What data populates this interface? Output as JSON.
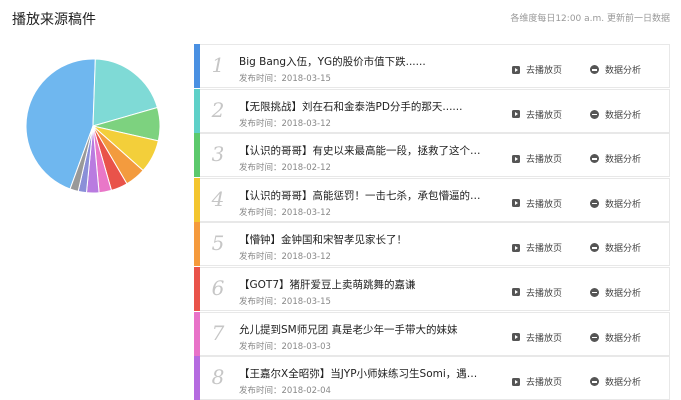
{
  "header": {
    "title": "播放来源稿件",
    "note": "各维度每日12:00 a.m. 更新前一日数据"
  },
  "actions": {
    "play_label": "去播放页",
    "analysis_label": "数据分析",
    "date_prefix": "发布时间："
  },
  "items": [
    {
      "rank": "1",
      "title": "Big Bang入伍，YG的股价市值下跌......",
      "date": "2018-03-15",
      "color": "#4a90e2"
    },
    {
      "rank": "2",
      "title": "【无限挑战】刘在石和金泰浩PD分手的那天......",
      "date": "2018-03-12",
      "color": "#5ed0c8"
    },
    {
      "rank": "3",
      "title": "【认识的哥哥】有史以来最高能一段，拯救了这个节目",
      "date": "2018-02-12",
      "color": "#5cc96c"
    },
    {
      "rank": "4",
      "title": "【认识的哥哥】高能惩罚！一击七杀，承包懵逼的王...",
      "date": "2018-03-12",
      "color": "#f3c52f"
    },
    {
      "rank": "5",
      "title": "【懵钟】金钟国和宋智孝见家长了！",
      "date": "2018-03-12",
      "color": "#f59a3c"
    },
    {
      "rank": "6",
      "title": "【GOT7】猪肝爱豆上卖萌跳舞的嘉谦",
      "date": "2018-03-15",
      "color": "#e9534a"
    },
    {
      "rank": "7",
      "title": "允儿提到SM师兄团 真是老少年一手带大的妹妹",
      "date": "2018-03-03",
      "color": "#e872c8"
    },
    {
      "rank": "8",
      "title": "【王嘉尔X全昭弥】当JYP小师妹练习生Somi，遇到师...",
      "date": "2018-02-04",
      "color": "#b56be0"
    }
  ],
  "chart_data": {
    "type": "pie",
    "values": [
      45,
      20,
      8,
      8,
      5,
      4,
      3,
      3,
      2,
      2
    ],
    "colors": [
      "#6fb7ef",
      "#7fdad6",
      "#7dd27f",
      "#f3cf3a",
      "#f39b3e",
      "#e9534a",
      "#e977c8",
      "#b97be0",
      "#8a8fd8",
      "#999999"
    ]
  }
}
